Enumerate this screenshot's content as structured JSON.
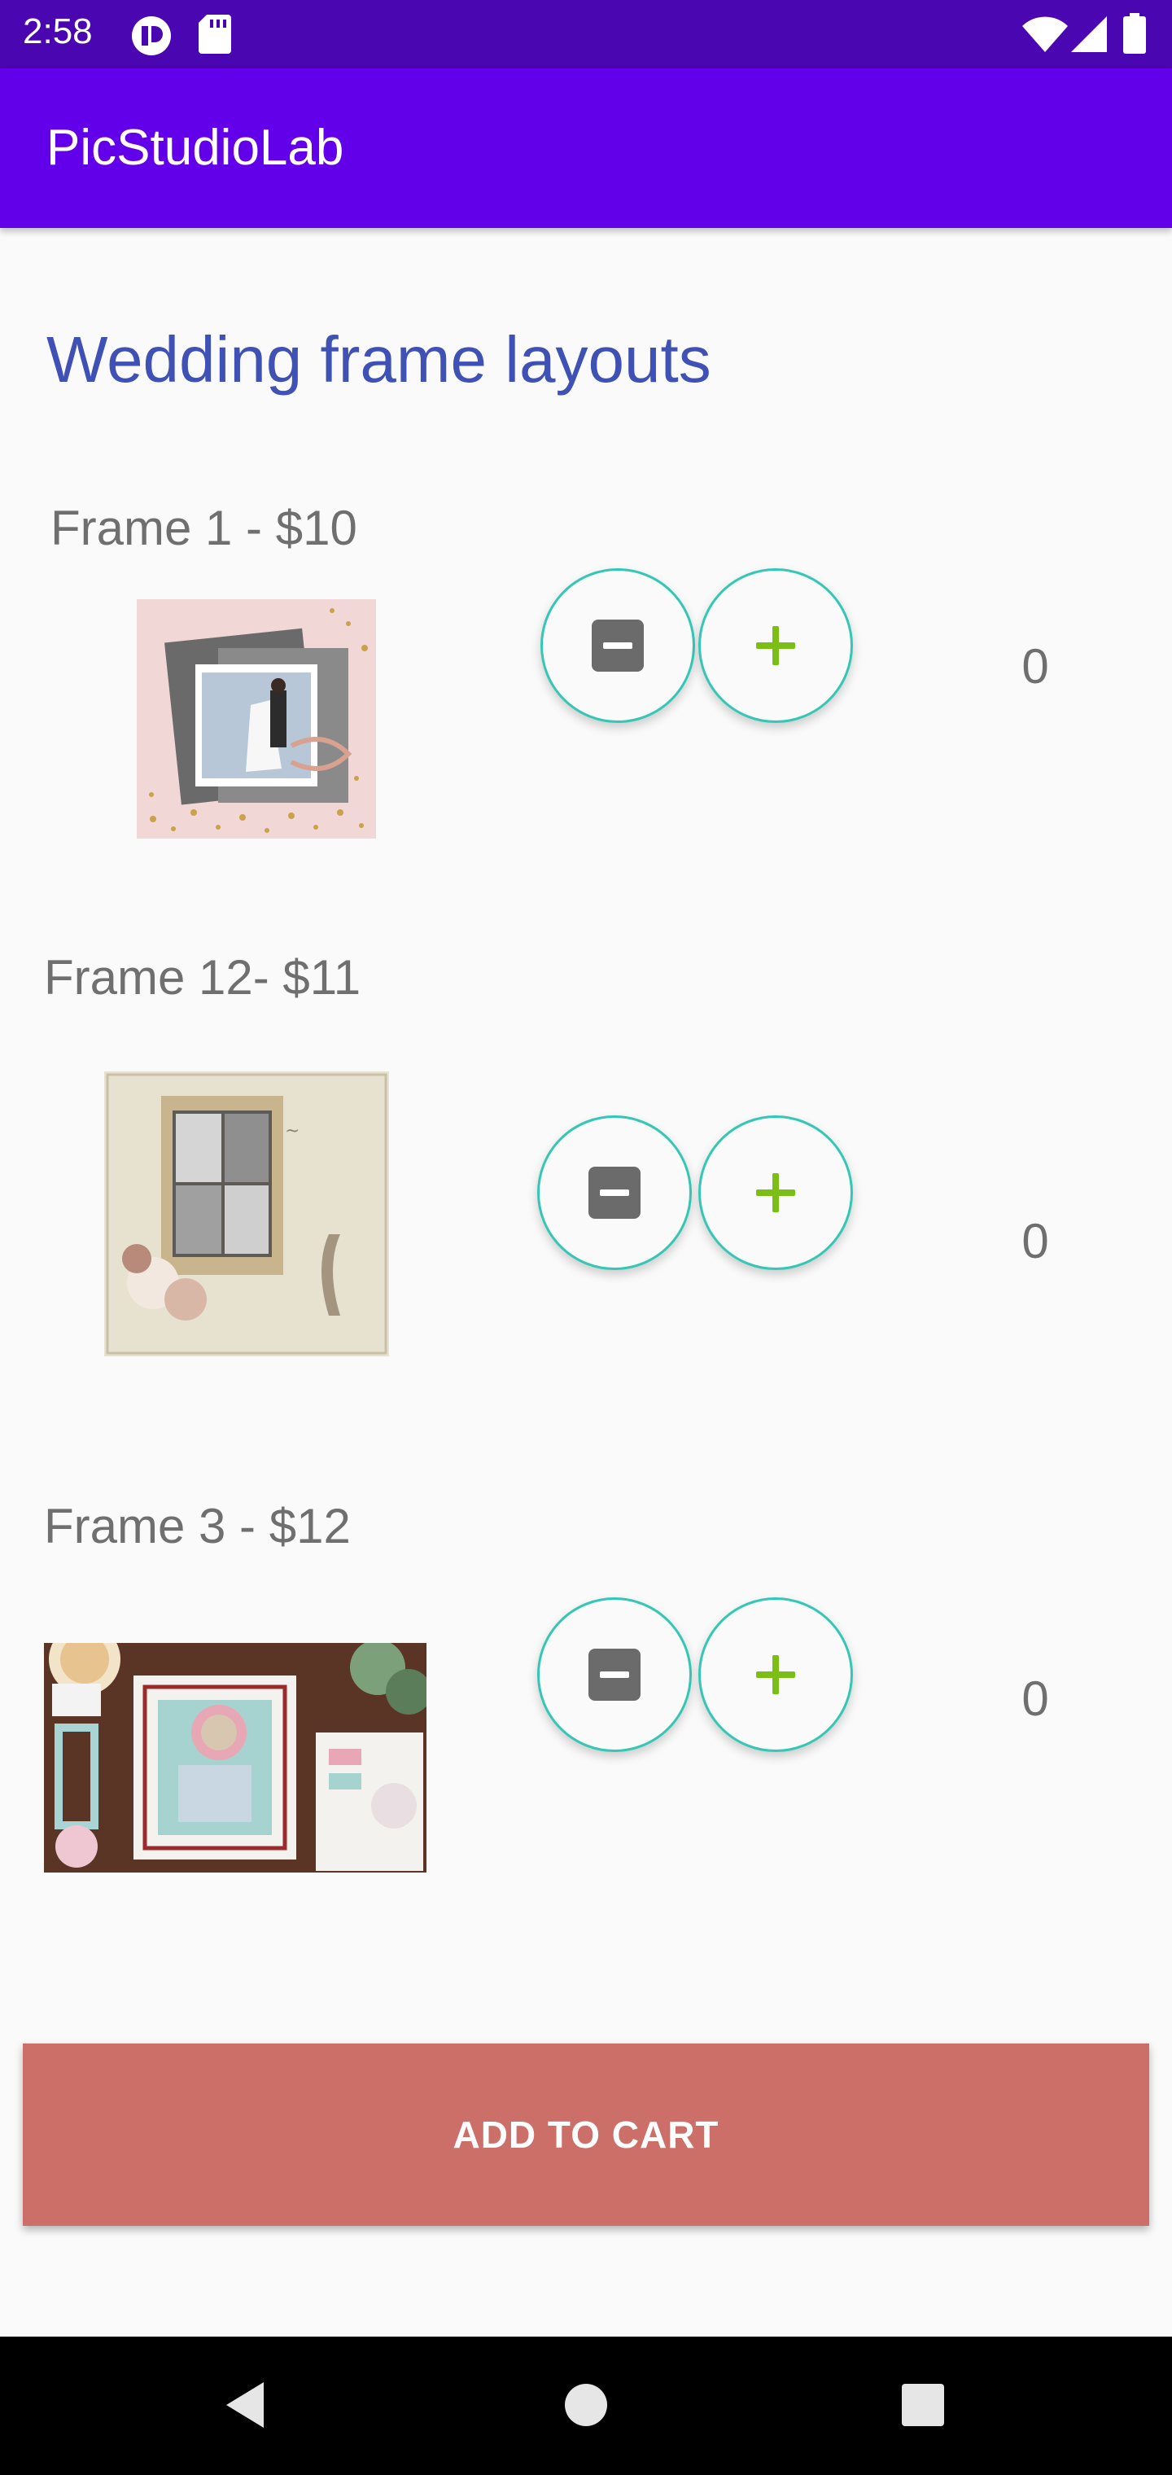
{
  "status_bar": {
    "time": "2:58",
    "icons": [
      "notification-app-icon",
      "sd-card-icon",
      "wifi-icon",
      "cell-signal-icon",
      "battery-icon"
    ]
  },
  "app_bar": {
    "title": "PicStudioLab"
  },
  "page": {
    "heading": "Wedding frame layouts"
  },
  "frames": [
    {
      "label": "Frame 1 - $10",
      "quantity": "0",
      "minus_icon": "minus-icon",
      "plus_icon": "plus-icon"
    },
    {
      "label": "Frame 12- $11",
      "quantity": "0",
      "minus_icon": "minus-icon",
      "plus_icon": "plus-icon"
    },
    {
      "label": "Frame 3 - $12",
      "quantity": "0",
      "minus_icon": "minus-icon",
      "plus_icon": "plus-icon"
    }
  ],
  "cart": {
    "button_label": "ADD TO CART"
  },
  "nav_bar": {
    "icons": [
      "back-icon",
      "home-icon",
      "recents-icon"
    ]
  },
  "colors": {
    "status_bar": "#4a06b0",
    "app_bar": "#6200ea",
    "heading": "#3f51b5",
    "button_outline": "#35c7b5",
    "plus": "#7bbf16",
    "cart_button": "#cd6f69"
  }
}
